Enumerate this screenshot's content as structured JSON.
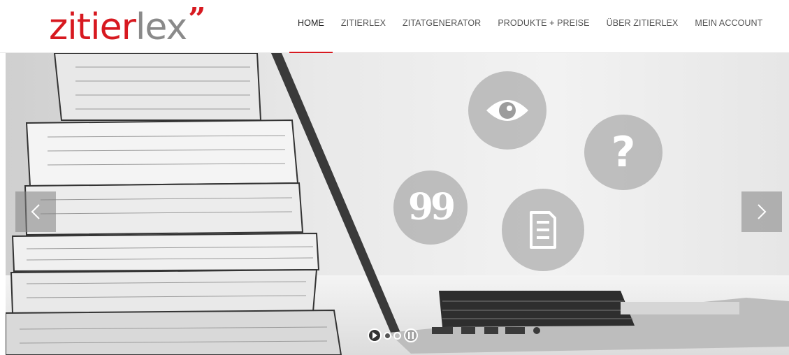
{
  "logo": {
    "part1": "zitier",
    "part2": "lex",
    "quote": "”"
  },
  "nav": {
    "items": [
      {
        "label": "HOME",
        "active": true
      },
      {
        "label": "ZITIERLEX",
        "active": false
      },
      {
        "label": "ZITATGENERATOR",
        "active": false
      },
      {
        "label": "PRODUKTE + PREISE",
        "active": false
      },
      {
        "label": "ÜBER ZITIERLEX",
        "active": false
      },
      {
        "label": "MEIN ACCOUNT",
        "active": false
      }
    ]
  },
  "hero": {
    "icons": [
      "eye-icon",
      "question-icon",
      "quote-icon",
      "document-icon"
    ],
    "question_glyph": "?",
    "quote_glyph": "99",
    "slider": {
      "prev": "prev-arrow-icon",
      "next": "next-arrow-icon",
      "slides": 2,
      "current": 1
    }
  },
  "colors": {
    "accent": "#d71920",
    "logo_grey": "#8a8a8a",
    "nav_text": "#555555"
  }
}
